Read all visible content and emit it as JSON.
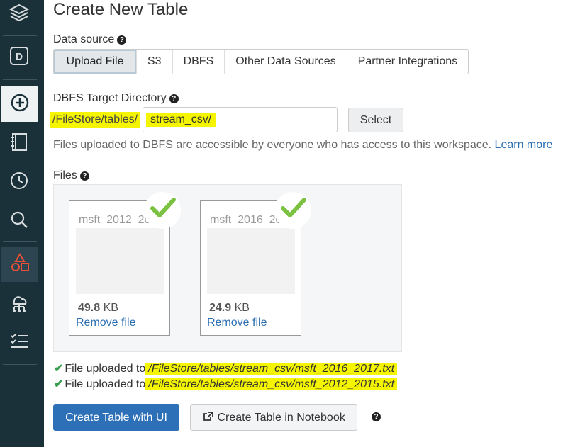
{
  "sidebar": {
    "items": [
      {
        "icon": "layers-icon"
      },
      {
        "icon": "workspace-d-icon",
        "letter": "D"
      },
      {
        "icon": "create-plus-icon"
      },
      {
        "icon": "notebook-icon"
      },
      {
        "icon": "clock-icon"
      },
      {
        "icon": "search-icon"
      },
      {
        "icon": "shapes-icon"
      },
      {
        "icon": "cluster-icon"
      },
      {
        "icon": "tasks-list-icon"
      }
    ]
  },
  "page": {
    "title": "Create New Table"
  },
  "data_source": {
    "label": "Data source",
    "tabs": [
      "Upload File",
      "S3",
      "DBFS",
      "Other Data Sources",
      "Partner Integrations"
    ],
    "selected": "Upload File"
  },
  "target": {
    "label": "DBFS Target Directory",
    "prefix": "/FileStore/tables/",
    "value": "stream_csv/",
    "select_label": "Select",
    "info_text": "Files uploaded to DBFS are accessible by everyone who has access to this workspace.",
    "learn_more": "Learn more"
  },
  "files": {
    "label": "Files",
    "items": [
      {
        "name": "msft_2012_201",
        "size_value": "49.8",
        "size_unit": "KB",
        "remove": "Remove file"
      },
      {
        "name": "msft_2016_201",
        "size_value": "24.9",
        "size_unit": "KB",
        "remove": "Remove file"
      }
    ]
  },
  "uploads": [
    {
      "text": "File uploaded to",
      "path": "/FileStore/tables/stream_csv/msft_2016_2017.txt"
    },
    {
      "text": "File uploaded to",
      "path": "/FileStore/tables/stream_csv/msft_2012_2015.txt"
    }
  ],
  "actions": {
    "create_ui": "Create Table with UI",
    "create_notebook": "Create Table in Notebook"
  },
  "colors": {
    "sidebar": "#1b3139",
    "primary": "#2d70b7",
    "highlight": "#f5f500",
    "check": "#7cc242"
  }
}
